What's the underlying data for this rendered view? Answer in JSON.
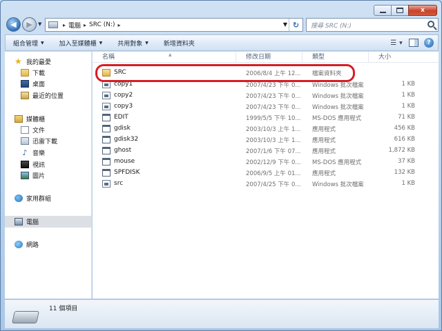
{
  "window": {
    "close_glyph": "x"
  },
  "address": {
    "crumbs": [
      "電腦",
      "SRC (N:)"
    ],
    "separator": "▸",
    "search_placeholder": "搜尋 SRC (N:)"
  },
  "toolbar": {
    "organize": "組合管理",
    "add_to_library": "加入至媒體櫃",
    "share": "共用對象",
    "new_folder": "新增資料夾"
  },
  "nav": {
    "favorites": "我的最愛",
    "downloads": "下載",
    "desktop": "桌面",
    "recent": "最近的位置",
    "libraries": "媒體櫃",
    "documents": "文件",
    "thunder": "迅雷下載",
    "music": "音樂",
    "videos": "視訊",
    "pictures": "圖片",
    "homegroup": "家用群組",
    "computer": "電腦",
    "network": "網路"
  },
  "columns": {
    "name": "名稱",
    "date": "修改日期",
    "type": "類型",
    "size": "大小"
  },
  "files": [
    {
      "name": "SRC",
      "date": "2006/8/4 上午 12...",
      "type": "檔案資料夾",
      "size": "",
      "icon": "folder-icon"
    },
    {
      "name": "copy1",
      "date": "2007/4/23 下午 0...",
      "type": "Windows 批次檔案",
      "size": "1 KB",
      "icon": "batch-file-icon"
    },
    {
      "name": "copy2",
      "date": "2007/4/23 下午 0...",
      "type": "Windows 批次檔案",
      "size": "1 KB",
      "icon": "batch-file-icon"
    },
    {
      "name": "copy3",
      "date": "2007/4/23 下午 0...",
      "type": "Windows 批次檔案",
      "size": "1 KB",
      "icon": "batch-file-icon"
    },
    {
      "name": "EDIT",
      "date": "1999/5/5 下午 10...",
      "type": "MS-DOS 應用程式",
      "size": "71 KB",
      "icon": "application-icon"
    },
    {
      "name": "gdisk",
      "date": "2003/10/3 上午 1...",
      "type": "應用程式",
      "size": "456 KB",
      "icon": "application-icon"
    },
    {
      "name": "gdisk32",
      "date": "2003/10/3 上午 1...",
      "type": "應用程式",
      "size": "616 KB",
      "icon": "application-icon"
    },
    {
      "name": "ghost",
      "date": "2007/1/6 下午 07...",
      "type": "應用程式",
      "size": "1,872 KB",
      "icon": "application-icon"
    },
    {
      "name": "mouse",
      "date": "2002/12/9 下午 0...",
      "type": "MS-DOS 應用程式",
      "size": "37 KB",
      "icon": "application-icon"
    },
    {
      "name": "SPFDISK",
      "date": "2006/9/5 上午 01...",
      "type": "應用程式",
      "size": "132 KB",
      "icon": "application-icon"
    },
    {
      "name": "src",
      "date": "2007/4/25 下午 0...",
      "type": "Windows 批次檔案",
      "size": "1 KB",
      "icon": "batch-file-icon"
    }
  ],
  "status": {
    "item_count": "11 個項目"
  },
  "colors": {
    "highlight": "#d81c24",
    "selected_nav": "#dcdfe4"
  }
}
